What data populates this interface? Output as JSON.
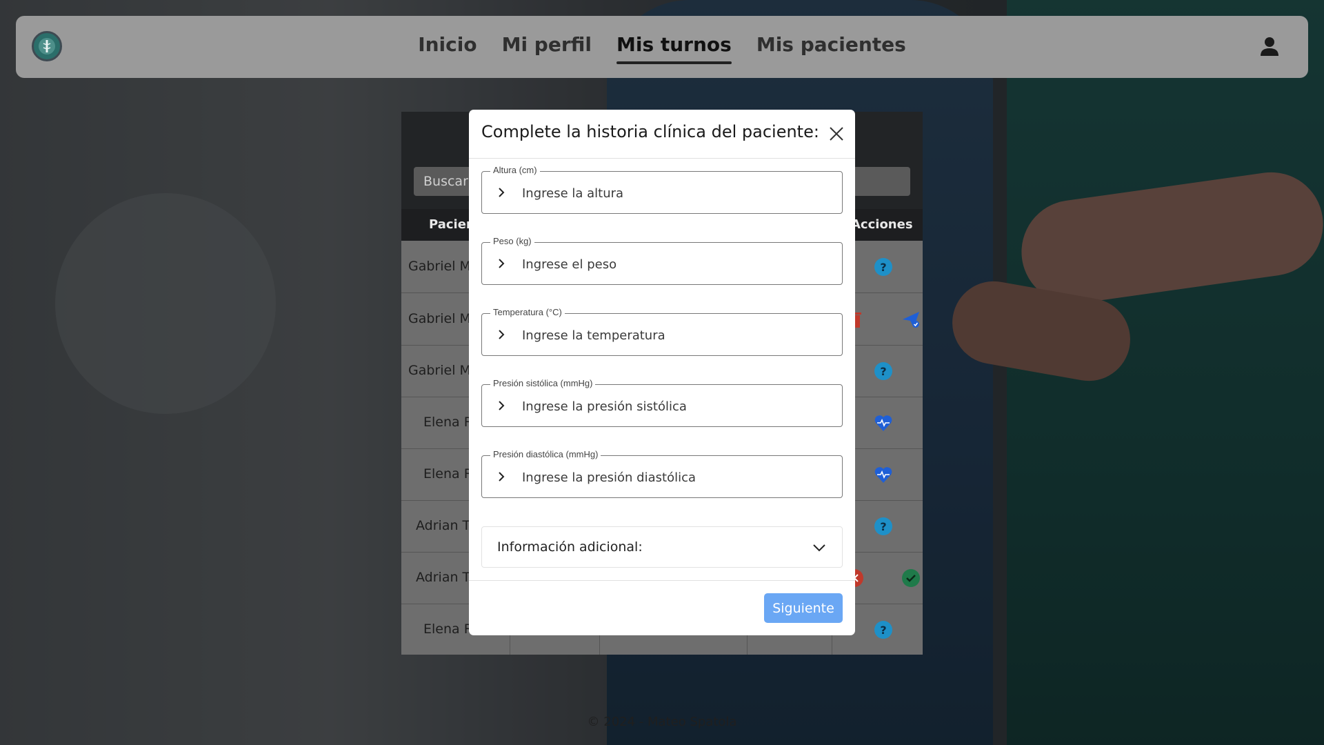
{
  "nav": {
    "links": [
      "Inicio",
      "Mi perfil",
      "Mis turnos",
      "Mis pacientes"
    ],
    "active_index": 2,
    "user_icon": "user-icon",
    "logo_icon": "caduceus-logo"
  },
  "table": {
    "search_placeholder": "Buscar",
    "headers": {
      "patient": "Pacien",
      "actions": "Acciones"
    },
    "rows": [
      {
        "name": "Gabriel Mo",
        "actions": [
          "help-icon"
        ]
      },
      {
        "name": "Gabriel Mo",
        "actions": [
          "trash-icon",
          "send-check-icon"
        ]
      },
      {
        "name": "Gabriel Mo",
        "actions": [
          "help-icon"
        ]
      },
      {
        "name": "Elena R",
        "actions": [
          "heart-pulse-icon"
        ]
      },
      {
        "name": "Elena R",
        "actions": [
          "heart-pulse-icon"
        ]
      },
      {
        "name": "Adrian To",
        "actions": [
          "help-icon"
        ]
      },
      {
        "name": "Adrian To",
        "actions": [
          "cancel-icon",
          "check-icon"
        ]
      },
      {
        "name": "Elena R",
        "actions": [
          "help-icon"
        ]
      }
    ]
  },
  "modal": {
    "title": "Complete la historia clínica del paciente:",
    "fields": [
      {
        "label": "Altura (cm)",
        "placeholder": "Ingrese la altura"
      },
      {
        "label": "Peso (kg)",
        "placeholder": "Ingrese el peso"
      },
      {
        "label": "Temperatura (°C)",
        "placeholder": "Ingrese la temperatura"
      },
      {
        "label": "Presión sistólica (mmHg)",
        "placeholder": "Ingrese la presión sistólica"
      },
      {
        "label": "Presión diastólica (mmHg)",
        "placeholder": "Ingrese la presión diastólica"
      }
    ],
    "accordion_label": "Información adicional:",
    "next_label": "Siguiente"
  },
  "footer": {
    "text": "© 2024 - Mateo Spatola"
  },
  "colors": {
    "primary_button": "#6aa7f4",
    "help_icon": "#1e90c8",
    "heart_icon": "#1f5fd6",
    "trash_icon": "#c0392b",
    "check_icon": "#1f7a4a"
  }
}
